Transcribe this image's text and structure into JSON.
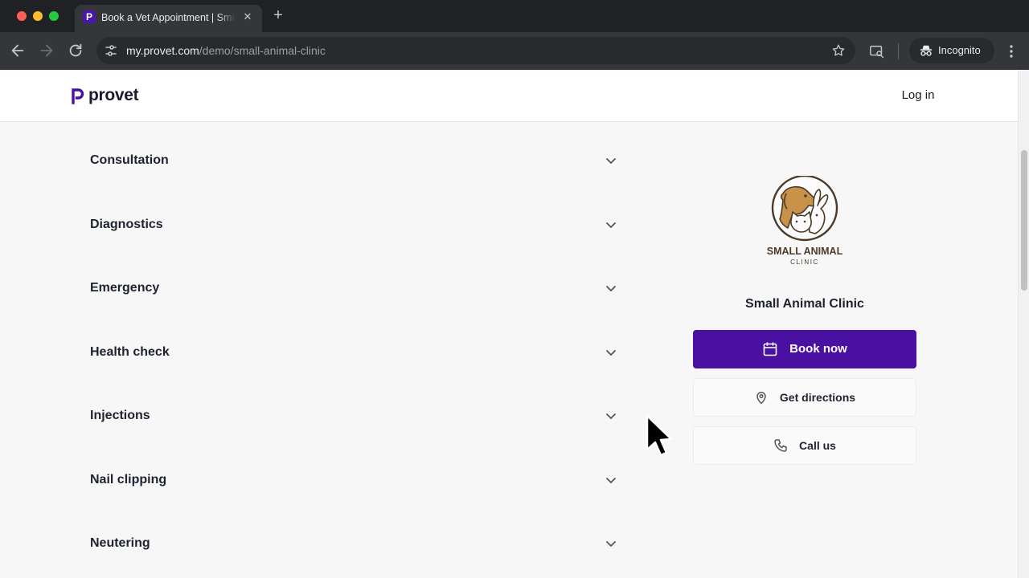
{
  "browser": {
    "tab_title": "Book a Vet Appointment | Small Animal Clinic",
    "tab_favicon_letter": "P",
    "tab_close": "✕",
    "new_tab": "+",
    "url_host": "my.provet.com",
    "url_path": "/demo/small-animal-clinic",
    "incognito_label": "Incognito"
  },
  "header": {
    "logo_text": "provet",
    "login_label": "Log in"
  },
  "services": [
    {
      "label": "Consultation"
    },
    {
      "label": "Diagnostics"
    },
    {
      "label": "Emergency"
    },
    {
      "label": "Health check"
    },
    {
      "label": "Injections"
    },
    {
      "label": "Nail clipping"
    },
    {
      "label": "Neutering"
    }
  ],
  "clinic": {
    "name": "Small Animal Clinic",
    "logo_line1": "SMALL ANIMAL",
    "logo_line2": "CLINIC",
    "book_label": "Book now",
    "directions_label": "Get directions",
    "call_label": "Call us"
  },
  "colors": {
    "brand_purple": "#4a10a1",
    "logo_brown": "#5a4326",
    "logo_tan": "#c8924a"
  },
  "icons": {
    "book": "calendar-icon",
    "directions": "map-pin-icon",
    "call": "phone-icon",
    "service_toggle": "chevron-down-icon"
  }
}
